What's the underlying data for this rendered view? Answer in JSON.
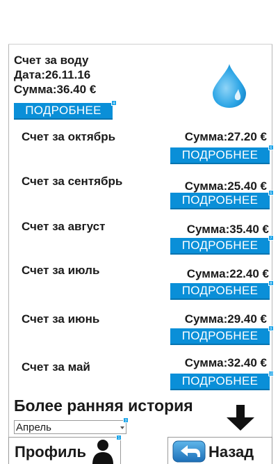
{
  "summary": {
    "title": "Счет за воду",
    "date": "Дата:26.11.16",
    "sum": "Сумма:36.40 €",
    "more_label": "ПОДРОБНЕЕ",
    "more_badge": "4"
  },
  "bills": [
    {
      "title": "Счет за октябрь",
      "sum": "Сумма:27.20 €",
      "more_label": "ПОДРОБНЕЕ",
      "badge": "6"
    },
    {
      "title": "Счет за сентябрь",
      "sum": "Сумма:25.40 €",
      "more_label": "ПОДРОБНЕЕ",
      "badge": "5"
    },
    {
      "title": "Счет за август",
      "sum": "Сумма:35.40 €",
      "more_label": "ПОДРОБНЕЕ",
      "badge": "7"
    },
    {
      "title": "Счет за июль",
      "sum": "Сумма:22.40 €",
      "more_label": "ПОДРОБНЕЕ",
      "badge": "8"
    },
    {
      "title": "Счет за июнь",
      "sum": "Сумма:29.40 €",
      "more_label": "ПОДРОБНЕЕ",
      "badge": "9"
    },
    {
      "title": "Счет за  май",
      "sum": "Сумма:32.40 €",
      "more_label": "ПОДРОБНЕЕ",
      "badge": "10"
    }
  ],
  "history": {
    "title": "Более ранняя история",
    "select_value": "Апрель",
    "select_badge": "3"
  },
  "footer": {
    "profile_label": "Профиль",
    "profile_badge": "1",
    "back_label": "Назад"
  },
  "colors": {
    "accent": "#0a8fd8",
    "drop": "#1e9be0"
  },
  "icons": {
    "drop": "water-drop-icon",
    "arrow": "arrow-down-icon",
    "person": "person-icon",
    "back": "back-arrow-icon"
  }
}
